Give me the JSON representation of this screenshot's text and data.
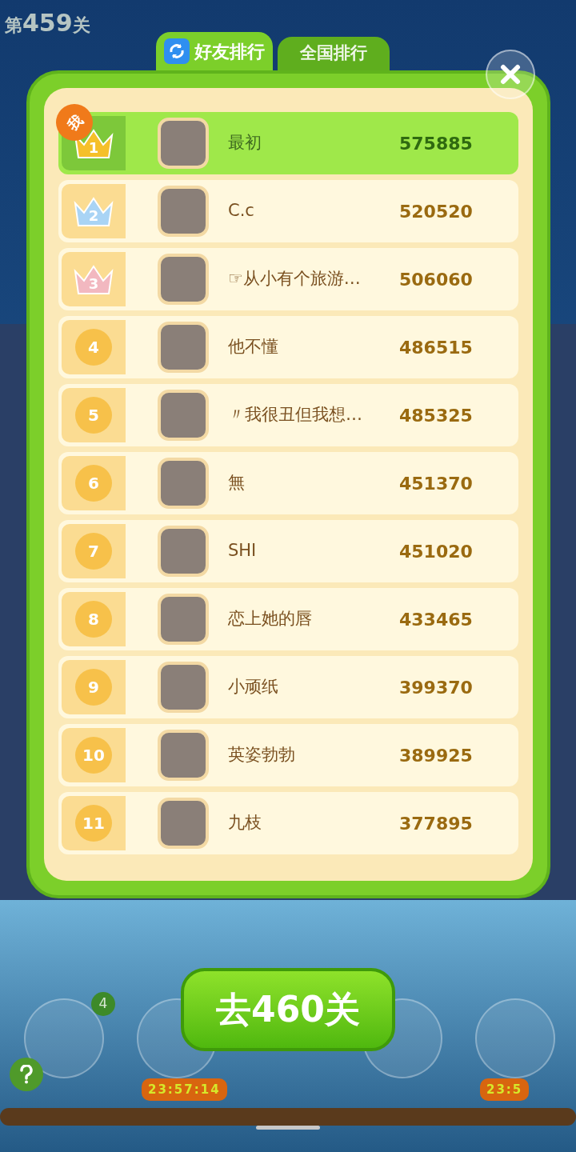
{
  "level": {
    "prefix": "第",
    "number": "459",
    "suffix": "关"
  },
  "tabs": [
    {
      "label": "好友排行",
      "selected": true
    },
    {
      "label": "全国排行",
      "selected": false
    }
  ],
  "me_tag": "我",
  "rows": [
    {
      "rank": "1",
      "kind": "crown",
      "color": "#f5c02a",
      "name": "最初",
      "score": "575885",
      "selected": true
    },
    {
      "rank": "2",
      "kind": "crown",
      "color": "#a9d4f5",
      "name": "C.c",
      "score": "520520",
      "selected": false
    },
    {
      "rank": "3",
      "kind": "crown",
      "color": "#f2b8c0",
      "name": "☞从小有个旅游…",
      "score": "506060",
      "selected": false
    },
    {
      "rank": "4",
      "kind": "circle",
      "name": "他不懂",
      "score": "486515",
      "selected": false
    },
    {
      "rank": "5",
      "kind": "circle",
      "name": "〃我很丑但我想…",
      "score": "485325",
      "selected": false
    },
    {
      "rank": "6",
      "kind": "circle",
      "name": "無",
      "score": "451370",
      "selected": false
    },
    {
      "rank": "7",
      "kind": "circle",
      "name": "SHI",
      "score": "451020",
      "selected": false
    },
    {
      "rank": "8",
      "kind": "circle",
      "name": "恋上她的唇",
      "score": "433465",
      "selected": false
    },
    {
      "rank": "9",
      "kind": "circle",
      "name": "小顽纸",
      "score": "399370",
      "selected": false
    },
    {
      "rank": "10",
      "kind": "circle",
      "name": "英姿勃勃",
      "score": "389925",
      "selected": false
    },
    {
      "rank": "11",
      "kind": "circle",
      "name": "九枝",
      "score": "377895",
      "selected": false
    }
  ],
  "next_button": "去460关",
  "boosters": [
    {
      "kind": "badge",
      "badge": "4"
    },
    {
      "kind": "timer",
      "timer": "23:57:14"
    },
    {
      "kind": "spacer"
    },
    {
      "kind": "plain"
    },
    {
      "kind": "timer",
      "timer": "23:5"
    }
  ]
}
